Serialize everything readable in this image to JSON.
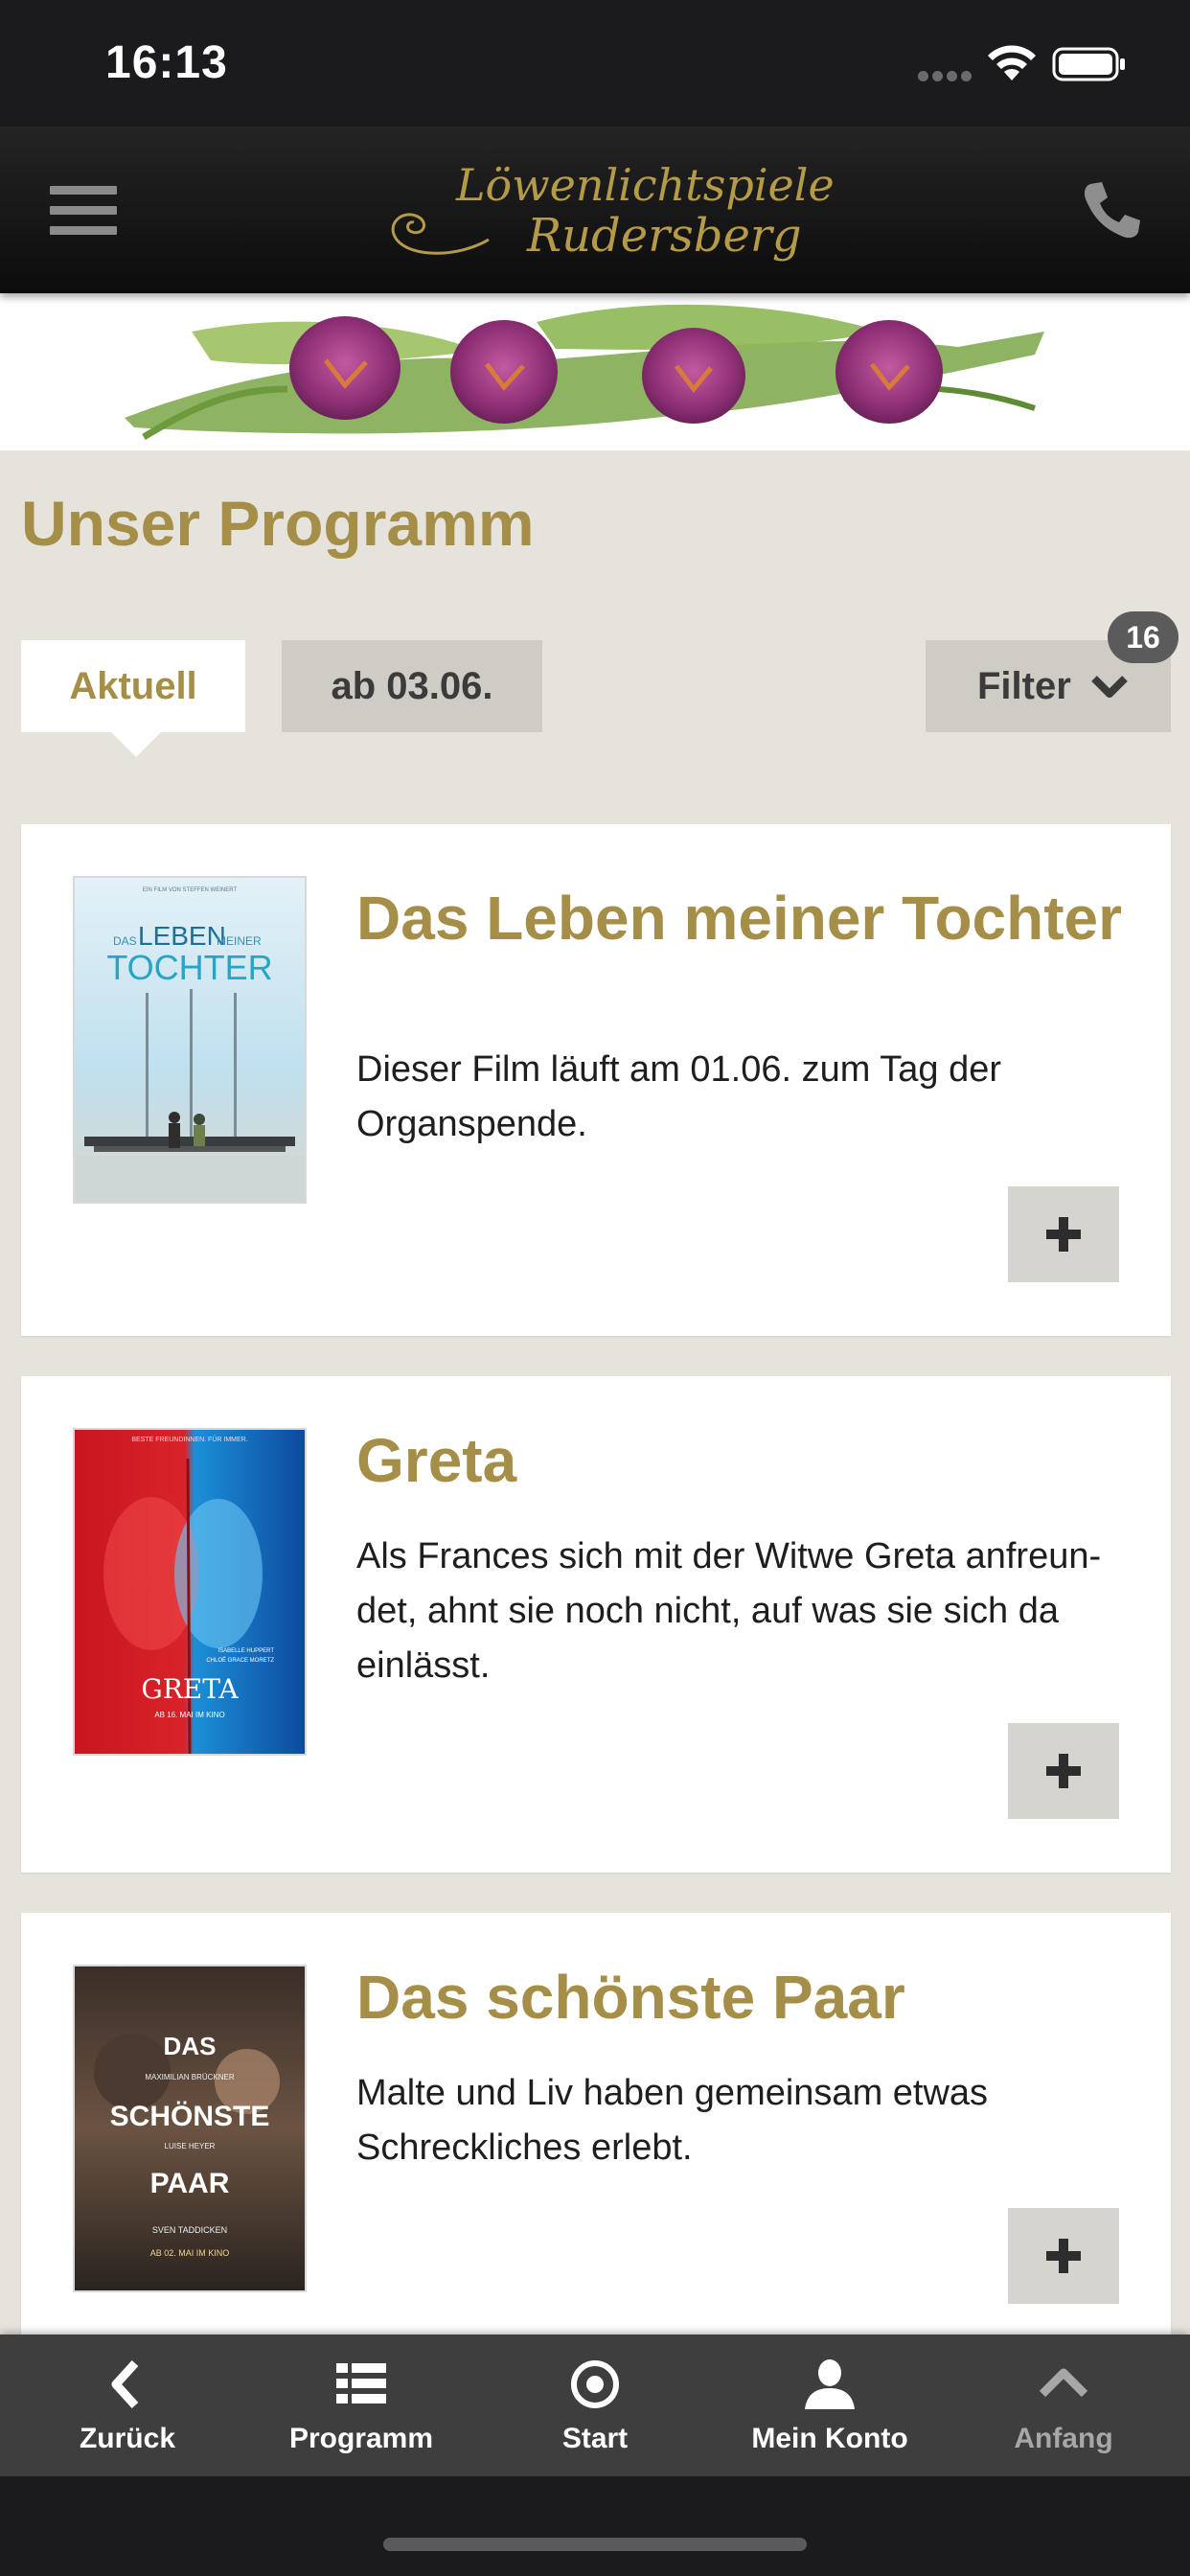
{
  "status_bar": {
    "time": "16:13"
  },
  "header": {
    "logo_line1": "Löwenlichtspiele",
    "logo_line2": "Rudersberg",
    "menu_icon": "hamburger-menu-icon",
    "phone_icon": "phone-icon"
  },
  "page": {
    "title": "Unser Programm"
  },
  "tabs": [
    {
      "label": "Aktuell",
      "active": true
    },
    {
      "label": "ab 03.06.",
      "active": false
    }
  ],
  "filter": {
    "label": "Filter",
    "badge": "16"
  },
  "films": [
    {
      "title": "Das Leben meiner Tochter",
      "description": "Dieser Film läuft am 01.06. zum Tag der Organspende.",
      "poster": {
        "top_line": "EIN FILM VON STEFFEN WEINERT",
        "title_a": "DAS",
        "title_b": "LEBEN",
        "title_c": "MEINER",
        "title_d": "TOCHTER"
      }
    },
    {
      "title": "Greta",
      "description": "Als Frances sich mit der Witwe Greta anfreun-det, ahnt sie noch nicht, auf was sie sich da einlässt.",
      "poster": {
        "top_line": "BESTE FREUNDINNEN. FÜR IMMER.",
        "title": "GRETA",
        "date": "AB 16. MAI IM KINO",
        "cast_1": "ISABELLE HUPPERT",
        "cast_2": "CHLOË GRACE MORETZ"
      }
    },
    {
      "title": "Das schönste Paar",
      "description": "Malte und Liv haben gemeinsam etwas Schreckliches erlebt.",
      "poster": {
        "title_1": "DAS",
        "actor_1": "MAXIMILIAN BRÜCKNER",
        "title_2": "SCHÖNSTE",
        "actor_2": "LUISE HEYER",
        "title_3": "PAAR",
        "director": "SVEN TADDICKEN",
        "date": "AB 02. MAI IM KINO"
      }
    }
  ],
  "tab_bar": [
    {
      "label": "Zurück",
      "icon": "chevron-left-icon"
    },
    {
      "label": "Programm",
      "icon": "list-icon"
    },
    {
      "label": "Start",
      "icon": "target-icon"
    },
    {
      "label": "Mein Konto",
      "icon": "user-icon"
    },
    {
      "label": "Anfang",
      "icon": "chevron-up-icon"
    }
  ],
  "colors": {
    "accent_gold": "#a58e47",
    "background": "#e6e3dd",
    "tab_bar": "#3e3e3e",
    "header": "#111111"
  }
}
